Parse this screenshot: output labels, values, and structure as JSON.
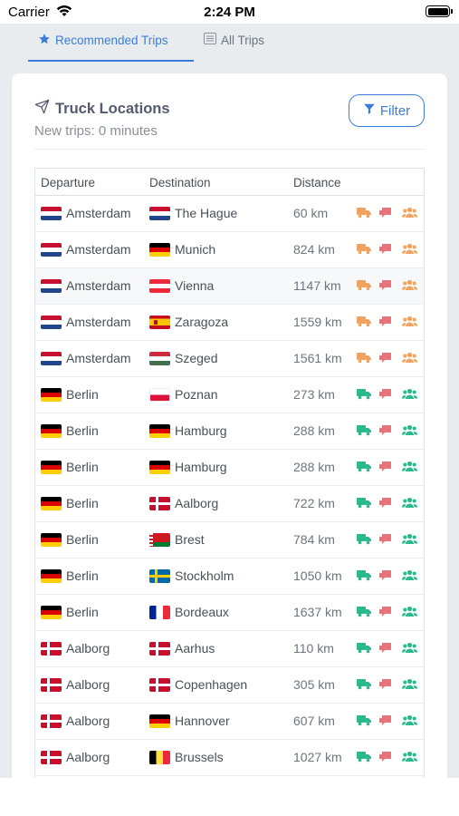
{
  "status_bar": {
    "carrier": "Carrier",
    "time": "2:24 PM"
  },
  "tabs": [
    {
      "label": "Recommended Trips",
      "icon": "star-icon",
      "active": true
    },
    {
      "label": "All Trips",
      "icon": "list-icon",
      "active": false
    }
  ],
  "card": {
    "title": "Truck Locations",
    "subtitle": "New trips: 0 minutes",
    "filter_label": "Filter"
  },
  "table": {
    "headers": [
      "Departure",
      "Destination",
      "Distance"
    ],
    "rows": [
      {
        "dep": "Amsterdam",
        "dep_flag": "nl",
        "dest": "The Hague",
        "dest_flag": "nl",
        "dist": "60 km",
        "status": "orange"
      },
      {
        "dep": "Amsterdam",
        "dep_flag": "nl",
        "dest": "Munich",
        "dest_flag": "de",
        "dist": "824 km",
        "status": "orange"
      },
      {
        "dep": "Amsterdam",
        "dep_flag": "nl",
        "dest": "Vienna",
        "dest_flag": "at",
        "dist": "1147 km",
        "status": "orange"
      },
      {
        "dep": "Amsterdam",
        "dep_flag": "nl",
        "dest": "Zaragoza",
        "dest_flag": "es",
        "dist": "1559 km",
        "status": "orange"
      },
      {
        "dep": "Amsterdam",
        "dep_flag": "nl",
        "dest": "Szeged",
        "dest_flag": "hu",
        "dist": "1561 km",
        "status": "orange"
      },
      {
        "dep": "Berlin",
        "dep_flag": "de",
        "dest": "Poznan",
        "dest_flag": "pl",
        "dist": "273 km",
        "status": "green"
      },
      {
        "dep": "Berlin",
        "dep_flag": "de",
        "dest": "Hamburg",
        "dest_flag": "de",
        "dist": "288 km",
        "status": "green"
      },
      {
        "dep": "Berlin",
        "dep_flag": "de",
        "dest": "Hamburg",
        "dest_flag": "de",
        "dist": "288 km",
        "status": "green"
      },
      {
        "dep": "Berlin",
        "dep_flag": "de",
        "dest": "Aalborg",
        "dest_flag": "dk",
        "dist": "722 km",
        "status": "green"
      },
      {
        "dep": "Berlin",
        "dep_flag": "de",
        "dest": "Brest",
        "dest_flag": "by",
        "dist": "784 km",
        "status": "green"
      },
      {
        "dep": "Berlin",
        "dep_flag": "de",
        "dest": "Stockholm",
        "dest_flag": "se",
        "dist": "1050 km",
        "status": "green"
      },
      {
        "dep": "Berlin",
        "dep_flag": "de",
        "dest": "Bordeaux",
        "dest_flag": "fr",
        "dist": "1637 km",
        "status": "green"
      },
      {
        "dep": "Aalborg",
        "dep_flag": "dk",
        "dest": "Aarhus",
        "dest_flag": "dk",
        "dist": "110 km",
        "status": "green"
      },
      {
        "dep": "Aalborg",
        "dep_flag": "dk",
        "dest": "Copenhagen",
        "dest_flag": "dk",
        "dist": "305 km",
        "status": "green"
      },
      {
        "dep": "Aalborg",
        "dep_flag": "dk",
        "dest": "Hannover",
        "dest_flag": "de",
        "dist": "607 km",
        "status": "green"
      },
      {
        "dep": "Aalborg",
        "dep_flag": "dk",
        "dest": "Brussels",
        "dest_flag": "be",
        "dist": "1027 km",
        "status": "green"
      }
    ]
  },
  "colors": {
    "accent": "#3b7ddd",
    "orange": "#f0a35e",
    "green": "#2bb88a",
    "red": "#e8737a"
  }
}
